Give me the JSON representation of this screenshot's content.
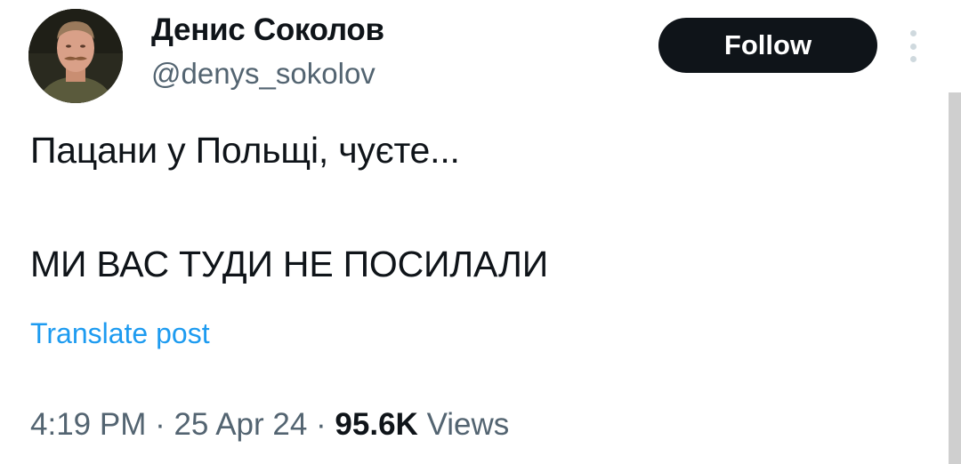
{
  "author": {
    "display_name": "Денис Соколов",
    "handle": "@denys_sokolov"
  },
  "actions": {
    "follow_label": "Follow",
    "more_icon": "more-vertical-icon"
  },
  "tweet": {
    "lines": [
      "Пацани у Польщі, чуєте...",
      "МИ ВАС ТУДИ НЕ ПОСИЛАЛИ"
    ],
    "translate_label": "Translate post"
  },
  "meta": {
    "time": "4:19 PM",
    "separator": " · ",
    "date": "25 Apr 24",
    "views_count": "95.6K",
    "views_label": "Views"
  },
  "colors": {
    "text": "#0f1419",
    "secondary": "#536471",
    "link": "#1d9bf0",
    "button_bg": "#0f1419"
  }
}
